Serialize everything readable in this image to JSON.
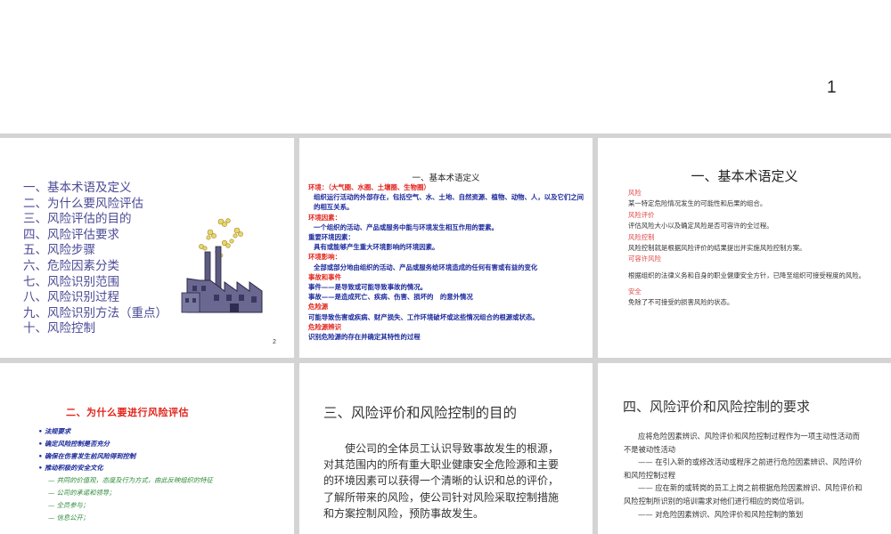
{
  "page": {
    "number": "1"
  },
  "slide1": {
    "toc": [
      "一、基本术语及定义",
      "二、为什么要风险评估",
      "三、风险评估的目的",
      "四、风险评估要求",
      "五、风险步骤",
      "六、危险因素分类",
      "七、风险识别范围",
      "八、风险识别过程",
      "九、风险识别方法（重点）",
      "十、风险控制"
    ],
    "slide_number": "2",
    "illustration": "factory-smokestacks-icon"
  },
  "slide2": {
    "title": "一、基本术语定义",
    "env_label": "环境：（大气圈、水圈、土壤圈、生物圈）",
    "env_text": "组织运行活动的外部存在，包括空气、水、土地、自然资源、植物、动物、人，以及它们之间的相互关系。",
    "factor_label": "环境因素：",
    "factor_text": "一个组织的活动、产品或服务中能与环境发生相互作用的要素。",
    "sig_label": "重要环境因素：",
    "sig_text": "具有或能够产生重大环境影响的环境因素。",
    "impact_label": "环境影响：",
    "impact_text": "全部或部分地由组织的活动、产品或服务给环境造成的任何有害或有益的变化",
    "event_label": "事故和事件",
    "event_text": "事件——是导致或可能导致事故的情况。",
    "accident_text": "事故——是造成死亡、疾病、伤害、损坏的　的意外情况",
    "hazard_label": "危险源",
    "hazard_text": "可能导致伤害或疾病、财产损失、工作环境破坏或这些情况组合的根源或状态。",
    "hazid_label": "危险源辨识",
    "hazid_text": "识别危险源的存在并确定其特性的过程"
  },
  "slide3": {
    "title": "一、基本术语定义",
    "items": [
      {
        "term": "风险",
        "def": "某一特定危险情况发生的可能性和后果的组合。"
      },
      {
        "term": "风险评价",
        "def": "评估风险大小以及确定风险是否可容许的全过程。"
      },
      {
        "term": "风险控制",
        "def": "风险控制就是根据风险评价的结果提出并实施风险控制方案。"
      },
      {
        "term": "可容许风险",
        "def": "根据组织的法律义务和自身的职业健康安全方针，已降至组织可接受程度的风险。"
      },
      {
        "term": "安全",
        "def": "免除了不可接受的损害风险的状态。"
      }
    ]
  },
  "slide4": {
    "title": "二、为什么要进行风险评估",
    "bullets": [
      "法规要求",
      "确定风险控制是否充分",
      "确保在伤害发生前风险得到控制",
      "推动积极的安全文化"
    ],
    "sub_items": [
      "— 共同的价值观，态度及行为方式，由此反映组织的特征",
      "— 公司的承诺和领导；",
      "— 全员参与；",
      "— 信息公开；"
    ]
  },
  "slide5": {
    "title": "三、风险评价和风险控制的目的",
    "body": "使公司的全体员工认识导致事故发生的根源，对其范围内的所有重大职业健康安全危险源和主要的环境因素可以获得一个清晰的认识和总的评价，了解所带来的风险，使公司针对风险采取控制措施和方案控制风险，预防事故发生。"
  },
  "slide6": {
    "title": "四、风险评价和风险控制的要求",
    "paras": [
      "应将危险因素辨识、风险评价和风险控制过程作为一项主动性活动而不是被动性活动",
      "—— 在引入新的或修改活动或程序之前进行危险因素辨识、风险评价和风险控制过程",
      "—— 应在新的或转岗的员工上岗之前根据危险因素辨识、风险评价和风险控制所识别的培训需求对他们进行相应的岗位培训。",
      "—— 对危险因素辨识、风险评价和风险控制的策划"
    ]
  }
}
